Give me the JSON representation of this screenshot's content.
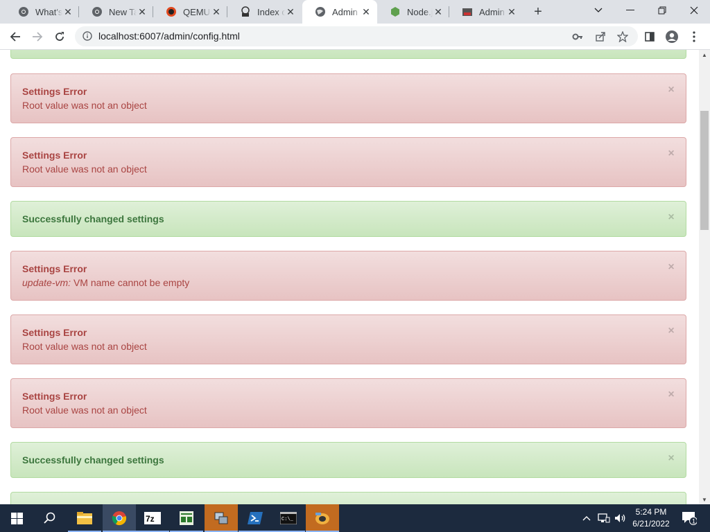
{
  "browser": {
    "tabs": [
      {
        "title": "What's New",
        "icon": "chrome-icon"
      },
      {
        "title": "New Tab",
        "icon": "chrome-icon"
      },
      {
        "title": "QEMU for Windows",
        "icon": "qemu-icon"
      },
      {
        "title": "Index of /",
        "icon": "index-icon"
      },
      {
        "title": "Admin Panel",
        "icon": "globe-icon"
      },
      {
        "title": "Node.js",
        "icon": "nodejs-icon"
      },
      {
        "title": "Admin Panel",
        "icon": "admin-icon"
      }
    ],
    "active_tab": 4,
    "url": "localhost:6007/admin/config.html"
  },
  "alerts": [
    {
      "type": "error",
      "heading": "Settings Error",
      "message": "Root value was not an object",
      "prefix": ""
    },
    {
      "type": "error",
      "heading": "Settings Error",
      "message": "Root value was not an object",
      "prefix": ""
    },
    {
      "type": "success",
      "heading": "Successfully changed settings",
      "message": "",
      "prefix": ""
    },
    {
      "type": "error",
      "heading": "Settings Error",
      "message": "VM name cannot be empty",
      "prefix": "update-vm:"
    },
    {
      "type": "error",
      "heading": "Settings Error",
      "message": "Root value was not an object",
      "prefix": ""
    },
    {
      "type": "error",
      "heading": "Settings Error",
      "message": "Root value was not an object",
      "prefix": ""
    },
    {
      "type": "success",
      "heading": "Successfully changed settings",
      "message": "",
      "prefix": ""
    }
  ],
  "close_glyph": "×",
  "taskbar": {
    "time": "5:24 PM",
    "date": "6/21/2022",
    "notification_count": "1",
    "apps": [
      "file-explorer-icon",
      "chrome-icon",
      "7zip-icon",
      "notepad-icon",
      "network-app-icon",
      "powershell-icon",
      "terminal-icon",
      "qemu-app-icon"
    ]
  },
  "colors": {
    "error_bg": "#f2dede",
    "error_text": "#a94442",
    "success_bg": "#dff0d8",
    "success_text": "#3c763d"
  }
}
